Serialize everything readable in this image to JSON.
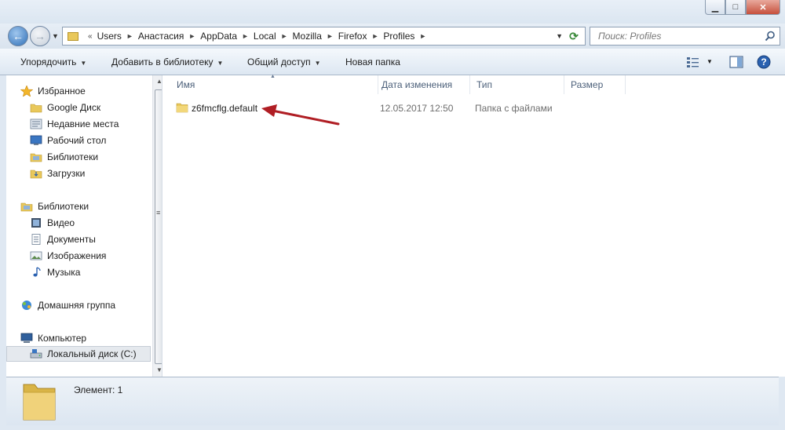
{
  "window": {
    "minimize": "▁",
    "maximize": "□",
    "close": "✕"
  },
  "nav": {
    "back": "←",
    "forward": "→",
    "history": "▼"
  },
  "address": {
    "overflow": "«",
    "crumbs": [
      "Users",
      "Анастасия",
      "AppData",
      "Local",
      "Mozilla",
      "Firefox",
      "Profiles"
    ],
    "refresh": "⟳"
  },
  "search": {
    "placeholder": "Поиск: Profiles"
  },
  "toolbar": {
    "organize": "Упорядочить",
    "add_to_library": "Добавить в библиотеку",
    "share": "Общий доступ",
    "new_folder": "Новая папка"
  },
  "sidebar": {
    "favorites": "Избранное",
    "google_drive": "Google Диск",
    "recent": "Недавние места",
    "desktop": "Рабочий стол",
    "libraries_fav": "Библиотеки",
    "downloads": "Загрузки",
    "libraries": "Библиотеки",
    "video": "Видео",
    "documents": "Документы",
    "images": "Изображения",
    "music": "Музыка",
    "homegroup": "Домашняя группа",
    "computer": "Компьютер",
    "local_disk": "Локальный диск (C:)"
  },
  "columns": {
    "name": "Имя",
    "modified": "Дата изменения",
    "type": "Тип",
    "size": "Размер"
  },
  "files": [
    {
      "name": "z6fmcflg.default",
      "modified": "12.05.2017 12:50",
      "type": "Папка с файлами",
      "size": ""
    }
  ],
  "status": {
    "items": "Элемент: 1"
  },
  "colors": {
    "annotation_arrow": "#b01e24",
    "folder": "#e9c85b"
  }
}
